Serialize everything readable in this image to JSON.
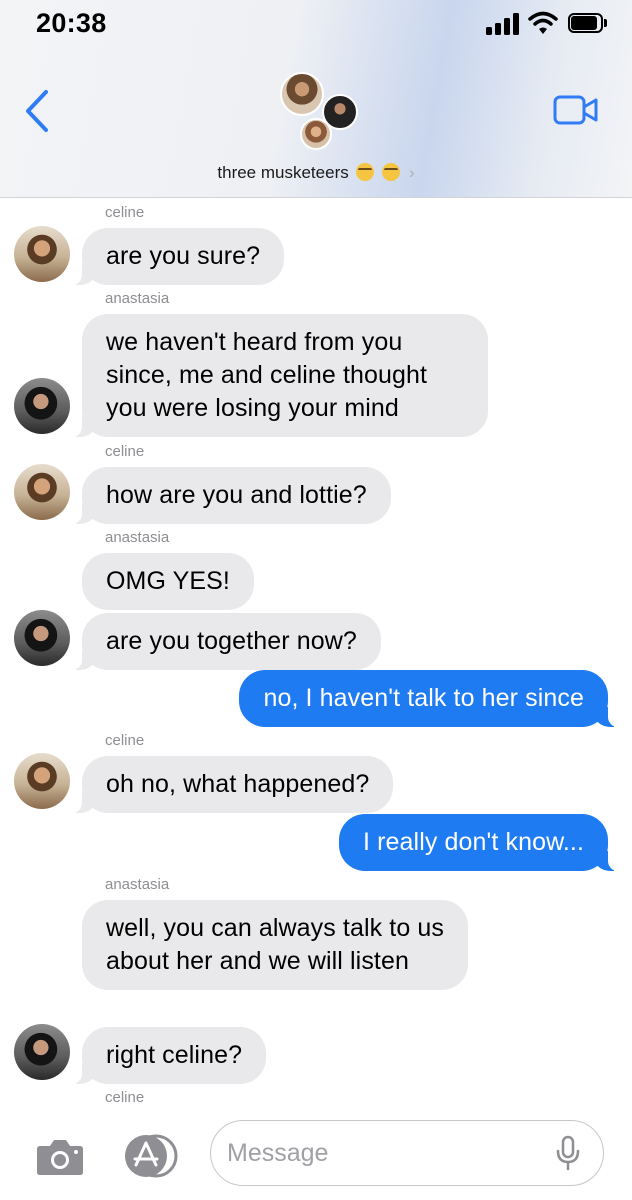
{
  "status_bar": {
    "time": "20:38",
    "icons": [
      "cellular-signal-icon",
      "wifi-icon",
      "battery-icon"
    ]
  },
  "header": {
    "group_name": "three musketeers",
    "group_emoji": [
      "smiling-face-with-glasses",
      "smiling-face-with-glasses"
    ],
    "chevron": "›",
    "icons": [
      "back-chevron-icon",
      "video-camera-icon"
    ]
  },
  "messages": [
    {
      "sender": "celine"
    },
    {
      "text": "are you sure?",
      "from": "celine",
      "direction": "incoming"
    },
    {
      "sender": "anastasia"
    },
    {
      "text": "we haven't heard from you since, me and celine thought you were losing your mind",
      "from": "anastasia",
      "direction": "incoming"
    },
    {
      "sender": "celine"
    },
    {
      "text": "how are you and lottie?",
      "from": "celine",
      "direction": "incoming"
    },
    {
      "sender": "anastasia"
    },
    {
      "text": "OMG YES!",
      "from": "anastasia",
      "direction": "incoming"
    },
    {
      "text": "are you together now?",
      "from": "anastasia",
      "direction": "incoming"
    },
    {
      "text": "no, I haven't talk to her since",
      "direction": "outgoing"
    },
    {
      "sender": "celine"
    },
    {
      "text": "oh no, what happened?",
      "from": "celine",
      "direction": "incoming"
    },
    {
      "text": "I really don't know...",
      "direction": "outgoing"
    },
    {
      "sender": "anastasia"
    },
    {
      "text": "well, you can always talk to us about her and we will listen",
      "from": "anastasia",
      "direction": "incoming"
    },
    {
      "text": "right celine?",
      "from": "anastasia",
      "direction": "incoming"
    },
    {
      "sender": "celine"
    }
  ],
  "input_bar": {
    "placeholder": "Message",
    "icons": [
      "camera-icon",
      "app-store-icon",
      "microphone-icon"
    ]
  },
  "colors": {
    "outgoing_bubble": "#1f7bf2",
    "incoming_bubble": "#e9e9eb",
    "accent": "#2f7cf6",
    "sender_label": "#8e8e93"
  }
}
